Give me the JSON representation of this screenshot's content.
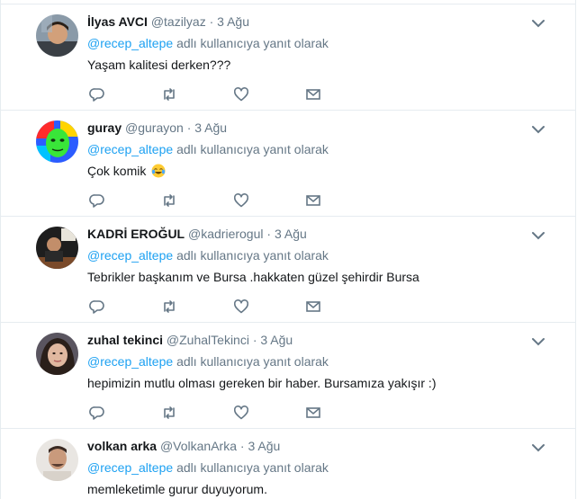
{
  "replying_to_label": "adlı kullanıcıya yanıt olarak",
  "mention": "@recep_altepe",
  "tweets": [
    {
      "fullname": "İlyas AVCI",
      "username": "@tazilyaz",
      "separator": "·",
      "time": "3 Ağu",
      "text": "Yaşam kalitesi derken???"
    },
    {
      "fullname": "guray",
      "username": "@gurayon",
      "separator": "·",
      "time": "3 Ağu",
      "text": "Çok komik",
      "emoji": "face-with-tears-of-joy"
    },
    {
      "fullname": "KADRİ EROĞUL",
      "username": "@kadrierogul",
      "separator": "·",
      "time": "3 Ağu",
      "text": "Tebrikler başkanım ve Bursa .hakkaten güzel şehirdir Bursa"
    },
    {
      "fullname": "zuhal tekinci",
      "username": "@ZuhalTekinci",
      "separator": "·",
      "time": "3 Ağu",
      "text": "hepimizin mutlu olması gereken bir haber. Bursamıza yakışır :)"
    },
    {
      "fullname": "volkan arka",
      "username": "@VolkanArka",
      "separator": "·",
      "time": "3 Ağu",
      "text": "memleketimle gurur duyuyorum."
    }
  ],
  "colors": {
    "link_blue": "#1da1f2",
    "secondary_gray": "#657786",
    "icon_gray": "#657786",
    "border": "#e6ecf0"
  },
  "icons": [
    "reply-icon",
    "retweet-icon",
    "like-icon",
    "direct-message-icon",
    "chevron-down-icon"
  ]
}
